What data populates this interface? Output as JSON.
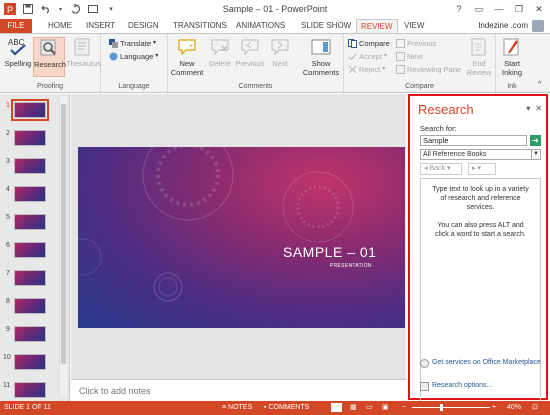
{
  "window": {
    "title": "Sample – 01 - PowerPoint"
  },
  "tabs": {
    "file": "FILE",
    "items": [
      "HOME",
      "INSERT",
      "DESIGN",
      "TRANSITIONS",
      "ANIMATIONS",
      "SLIDE SHOW",
      "REVIEW",
      "VIEW"
    ],
    "active": "REVIEW",
    "user": "Indezine .com"
  },
  "ribbon": {
    "proofing": {
      "label": "Proofing",
      "spelling": "Spelling",
      "research": "Research",
      "thesaurus": "Thesaurus"
    },
    "language": {
      "label": "Language",
      "translate": "Translate",
      "language": "Language"
    },
    "comments": {
      "label": "Comments",
      "new_comment_1": "New",
      "new_comment_2": "Comment",
      "delete": "Delete",
      "previous": "Previous",
      "next": "Next",
      "show_comments_1": "Show",
      "show_comments_2": "Comments"
    },
    "compare": {
      "label": "Compare",
      "compare": "Compare",
      "accept": "Accept",
      "reject": "Reject",
      "previous": "Previous",
      "next": "Next",
      "reviewing_pane": "Reviewing Pane",
      "end_review_1": "End",
      "end_review_2": "Review"
    },
    "ink": {
      "label": "Ink",
      "start_inking_1": "Start",
      "start_inking_2": "Inking"
    }
  },
  "thumbnails": {
    "numbers": [
      "1",
      "2",
      "3",
      "4",
      "5",
      "6",
      "7",
      "8",
      "9",
      "10",
      "11"
    ],
    "selected": "1"
  },
  "slide": {
    "title": "SAMPLE – 01",
    "subtitle": "PRESENTATION"
  },
  "notes": {
    "placeholder": "Click to add notes"
  },
  "research": {
    "title": "Research",
    "search_label": "Search for:",
    "search_value": "Sample",
    "reference": "All Reference Books",
    "back": "Back",
    "message_1": "Type text to look up in a variety of research and reference services.",
    "message_2": "You can also press ALT and click a word to start a search.",
    "get_services": "Get services on Office Marketplace",
    "options": "Research options..."
  },
  "status": {
    "slide": "SLIDE 1 OF 11",
    "notes": "NOTES",
    "comments": "COMMENTS",
    "zoom": "40%"
  },
  "colors": {
    "accent": "#d24726",
    "highlight_border": "#e0131c"
  }
}
